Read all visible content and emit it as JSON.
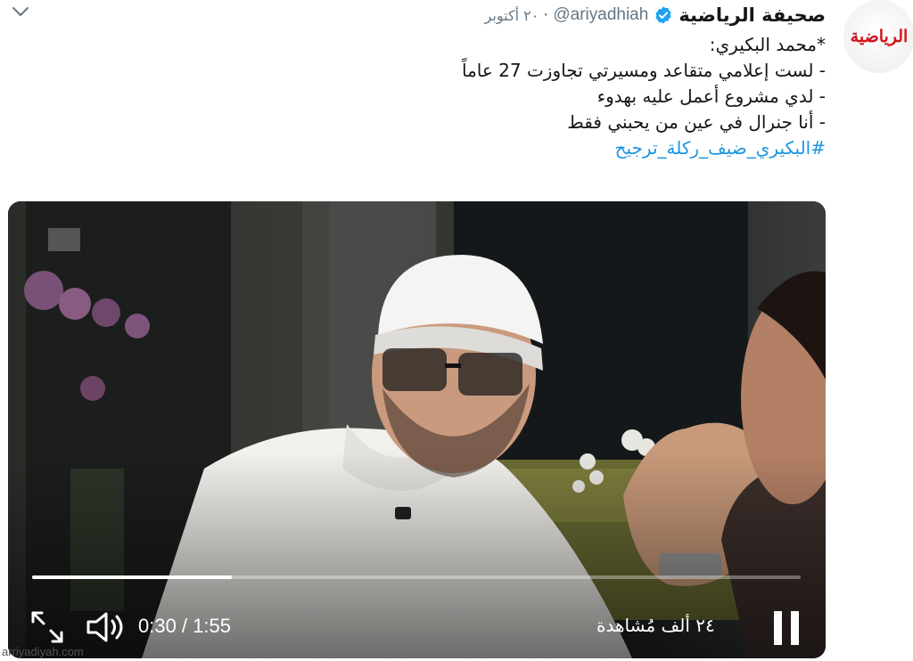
{
  "tweet": {
    "author_name": "صحيفة الرياضية",
    "handle": "@ariyadhiah",
    "separator": "·",
    "date": "٢٠ أكتوبر",
    "avatar_logo_text": "الرياضية",
    "lines": [
      "*محمد البكيري:",
      "- لست إعلامي متقاعد ومسيرتي تجاوزت 27 عاماً",
      "-  لدي مشروع أعمل عليه بهدوء",
      "- أنا جنرال في عين من يحبني فقط"
    ],
    "hashtag": "#البكيري_ضيف_ركلة_ترجيح"
  },
  "video": {
    "time_display": "0:30 / 1:55",
    "views": "٢٤ ألف مُشاهدة",
    "progress": 0.26,
    "icons": {
      "expand": "expand-icon",
      "volume": "volume-icon",
      "pause": "pause-icon",
      "verified": "verified-badge-icon",
      "more": "chevron-down-icon"
    }
  },
  "watermark": "arriyadiyah.com",
  "colors": {
    "hashtag": "#1b95e0",
    "verified": "#1da1f2",
    "secondary_text": "#657786",
    "logo_red": "#d0141a"
  }
}
